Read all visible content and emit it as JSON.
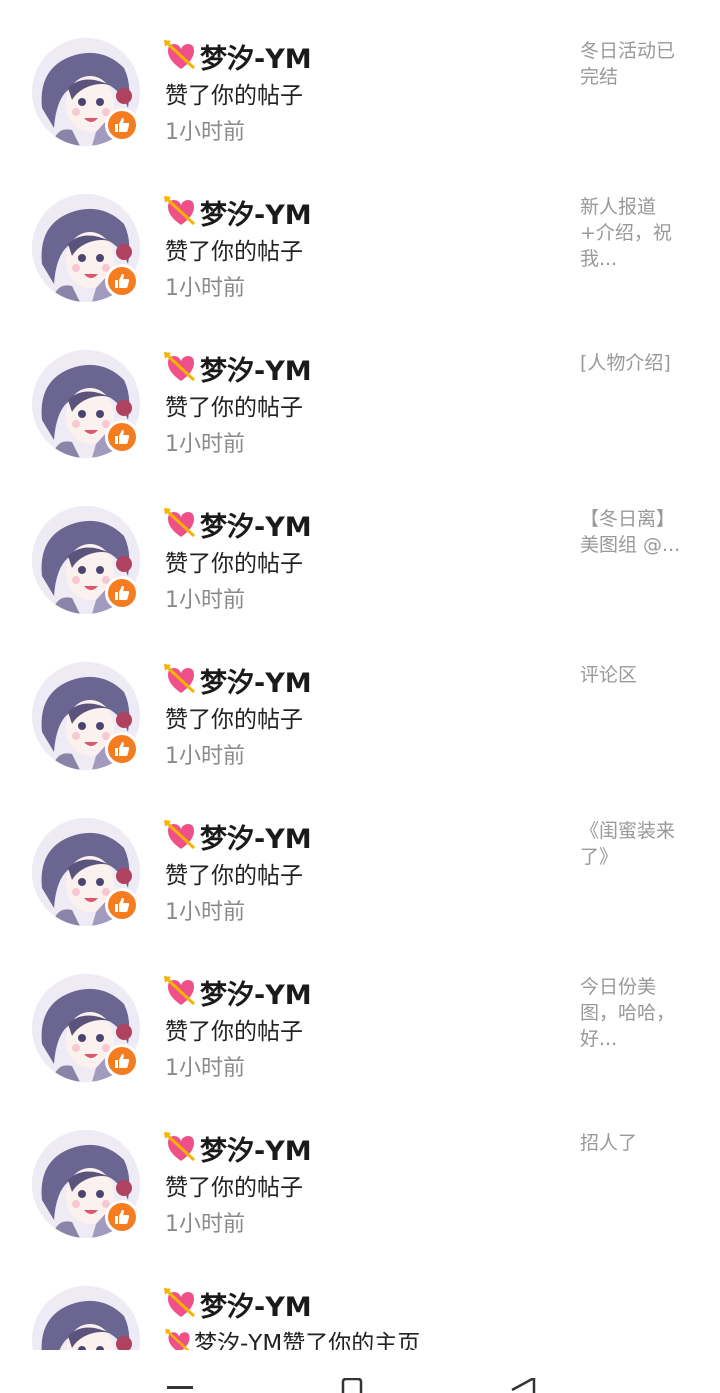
{
  "notifications": [
    {
      "user": "梦汐-YM",
      "action": "赞了你的帖子",
      "time": "1小时前",
      "post": "冬日活动已完结"
    },
    {
      "user": "梦汐-YM",
      "action": "赞了你的帖子",
      "time": "1小时前",
      "post": "新人报道+介绍，祝我..."
    },
    {
      "user": "梦汐-YM",
      "action": "赞了你的帖子",
      "time": "1小时前",
      "post": "[人物介绍]"
    },
    {
      "user": "梦汐-YM",
      "action": "赞了你的帖子",
      "time": "1小时前",
      "post": "【冬日离】美图组 @..."
    },
    {
      "user": "梦汐-YM",
      "action": "赞了你的帖子",
      "time": "1小时前",
      "post": "评论区"
    },
    {
      "user": "梦汐-YM",
      "action": "赞了你的帖子",
      "time": "1小时前",
      "post": "《闺蜜装来了》"
    },
    {
      "user": "梦汐-YM",
      "action": "赞了你的帖子",
      "time": "1小时前",
      "post": "今日份美图，哈哈，好..."
    },
    {
      "user": "梦汐-YM",
      "action": "赞了你的帖子",
      "time": "1小时前",
      "post": "招人了"
    },
    {
      "user": "梦汐-YM",
      "action": "梦汐-YM赞了你的主页",
      "time": "",
      "post": ""
    }
  ],
  "icons": {
    "user_badge": "heart-arrow-icon",
    "avatar_badge": "thumbs-up-icon",
    "nav": [
      "menu-icon",
      "home-icon",
      "back-icon"
    ]
  },
  "colors": {
    "badge": "#f57c1f",
    "heart": "#f0508a",
    "secondary_text": "#8a8a8a"
  }
}
